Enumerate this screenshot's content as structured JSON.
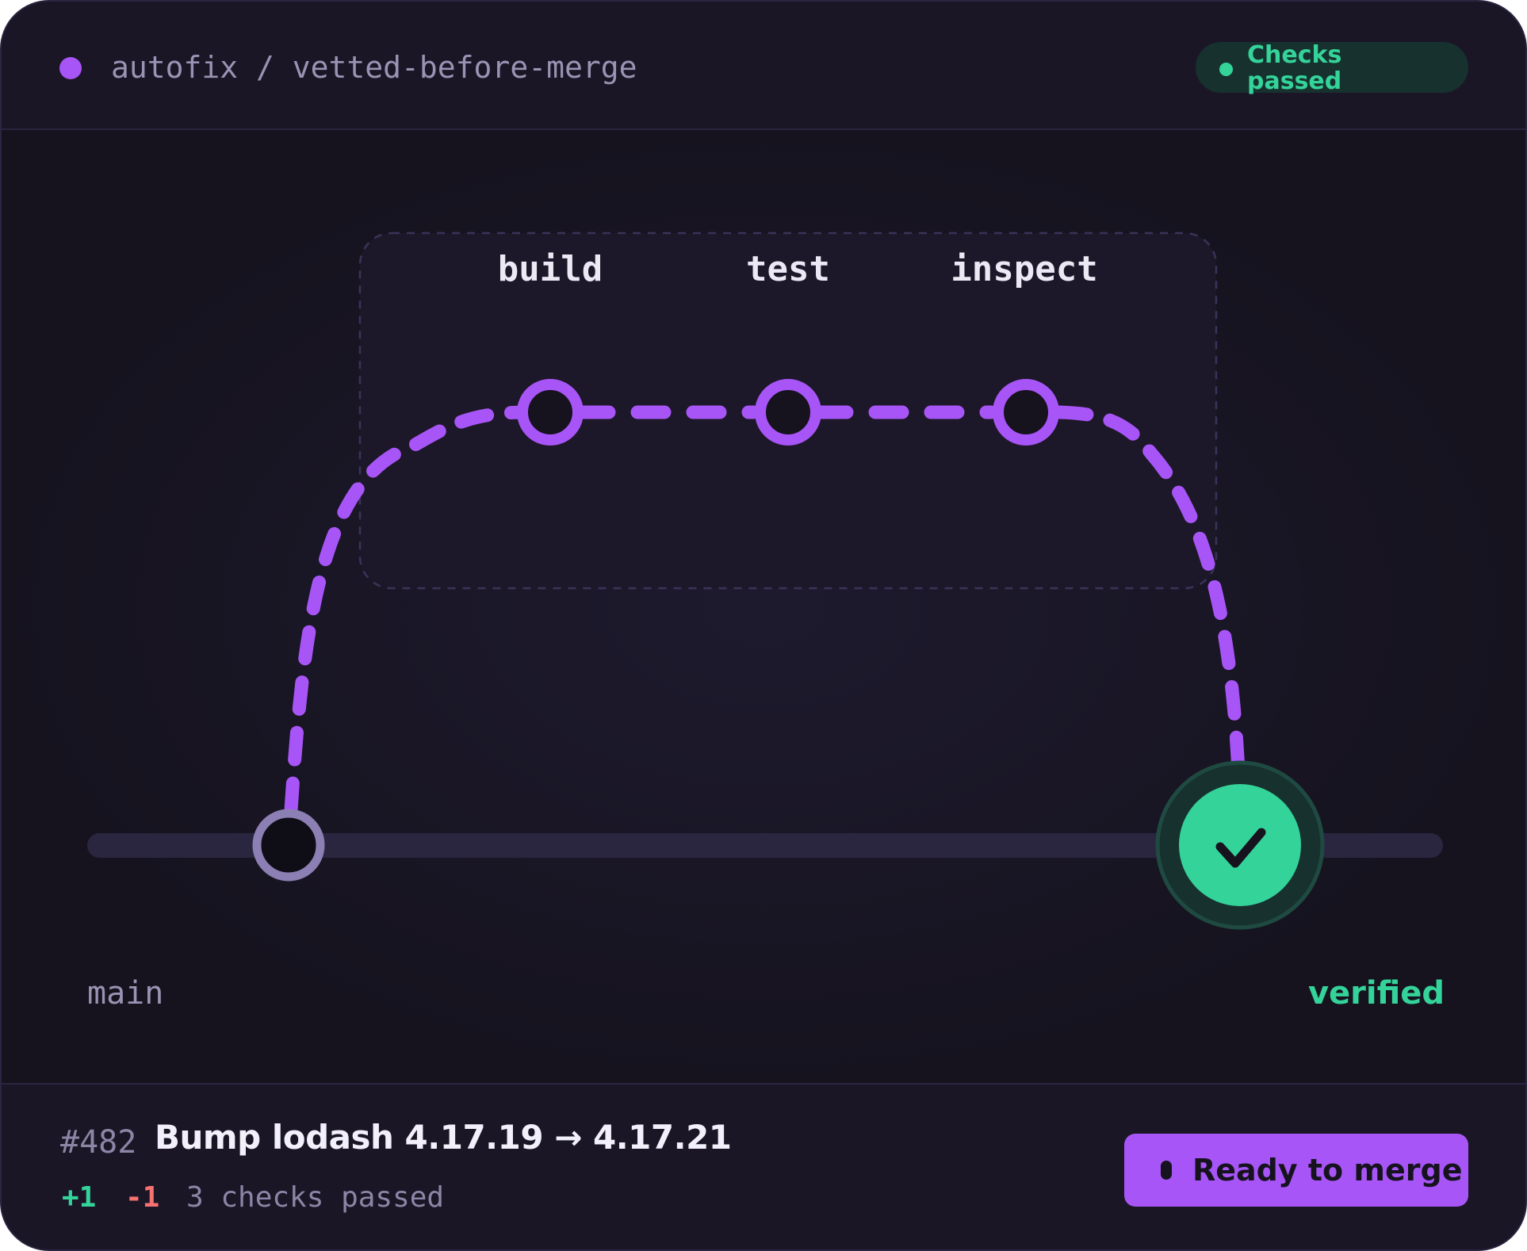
{
  "header": {
    "repo_path": "autofix / vetted-before-merge",
    "status": "Checks passed"
  },
  "pipeline": {
    "stages": [
      "build",
      "test",
      "inspect"
    ],
    "base_branch": "main",
    "result": "verified"
  },
  "pull_request": {
    "number": "#482",
    "title": "Bump lodash 4.17.19 → 4.17.21",
    "additions": "+1",
    "deletions": "-1",
    "checks": "3 checks passed",
    "action_label": "Ready to merge"
  },
  "colors": {
    "accent": "#a855f7",
    "success": "#34d399",
    "danger": "#f87171",
    "background": "#16131f"
  }
}
